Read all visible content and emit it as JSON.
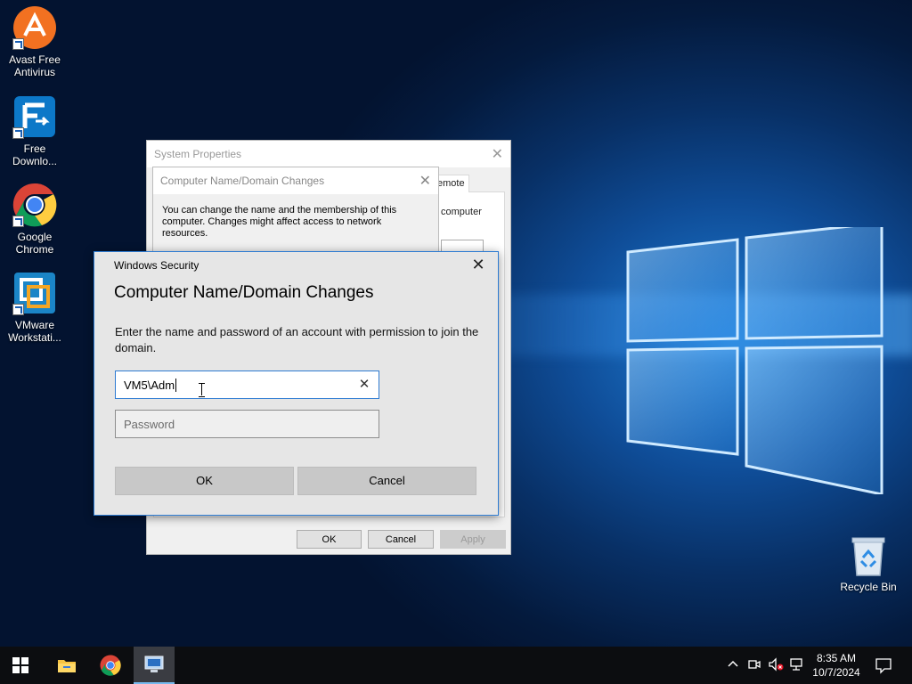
{
  "desktop": {
    "icons": [
      {
        "label_line1": "Avast Free",
        "label_line2": "Antivirus",
        "icon": "avast-icon"
      },
      {
        "label_line1": "Free",
        "label_line2": "Downlo...",
        "icon": "free-download-manager-icon"
      },
      {
        "label_line1": "Google",
        "label_line2": "Chrome",
        "icon": "chrome-icon"
      },
      {
        "label_line1": "VMware",
        "label_line2": "Workstati...",
        "icon": "vmware-icon"
      }
    ],
    "recycle_bin": "Recycle Bin"
  },
  "system_properties": {
    "title": "System Properties",
    "tab_partial": "emote",
    "text_partial": "computer",
    "buttons": {
      "ok": "OK",
      "cancel": "Cancel",
      "apply": "Apply"
    }
  },
  "domain_changes_window": {
    "title": "Computer Name/Domain Changes",
    "description_line1": "You can change the name and the membership of this",
    "description_line2": "computer. Changes might affect access to network resources."
  },
  "windows_security": {
    "title": "Windows Security",
    "heading": "Computer Name/Domain Changes",
    "message": "Enter the name and password of an account with permission to join the domain.",
    "username_value": "VM5\\Adm",
    "password_placeholder": "Password",
    "ok_label": "OK",
    "cancel_label": "Cancel"
  },
  "taskbar": {
    "time": "8:35 AM",
    "date": "10/7/2024"
  },
  "colors": {
    "accent": "#2d7bd2",
    "taskbar": "#0c0d10"
  }
}
